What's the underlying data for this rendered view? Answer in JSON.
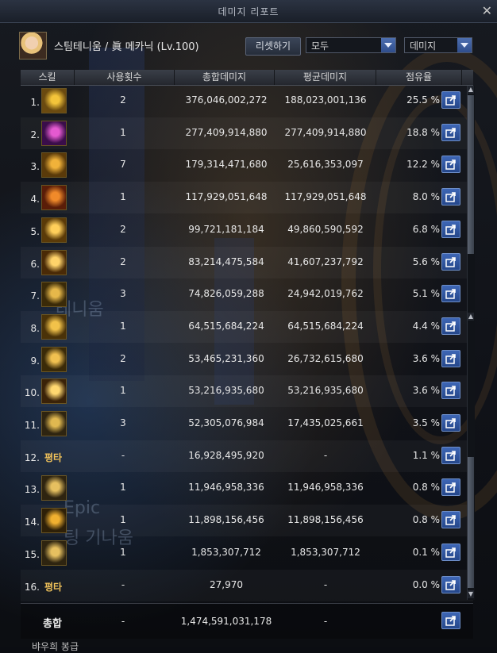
{
  "window": {
    "title": "데미지 리포트"
  },
  "character": {
    "name": "스팀테니움 / 眞 메카닉 (Lv.100)"
  },
  "controls": {
    "reset_label": "리셋하기",
    "filter_value": "모두",
    "metric_value": "데미지"
  },
  "columns": {
    "skill": "스킬",
    "uses": "사용횟수",
    "total": "총합데미지",
    "avg": "평균데미지",
    "share": "점유율"
  },
  "rows": [
    {
      "rank": "1.",
      "uses": "2",
      "total": "376,046,002,272",
      "avg": "188,023,001,136",
      "share": "25.5 %",
      "icon": "rifle-skill-icon"
    },
    {
      "rank": "2.",
      "uses": "1",
      "total": "277,409,914,880",
      "avg": "277,409,914,880",
      "share": "18.8 %",
      "icon": "purple-hex-skill-icon"
    },
    {
      "rank": "3.",
      "uses": "7",
      "total": "179,314,471,680",
      "avg": "25,616,353,097",
      "share": "12.2 %",
      "icon": "missile-barrage-icon"
    },
    {
      "rank": "4.",
      "uses": "1",
      "total": "117,929,051,648",
      "avg": "117,929,051,648",
      "share": "8.0 %",
      "icon": "robot-helmet-icon"
    },
    {
      "rank": "5.",
      "uses": "2",
      "total": "99,721,181,184",
      "avg": "49,860,590,592",
      "share": "6.8 %",
      "icon": "mech-fist-icon"
    },
    {
      "rank": "6.",
      "uses": "2",
      "total": "83,214,475,584",
      "avg": "41,607,237,792",
      "share": "5.6 %",
      "icon": "laser-beam-icon"
    },
    {
      "rank": "7.",
      "uses": "3",
      "total": "74,826,059,288",
      "avg": "24,942,019,762",
      "share": "5.1 %",
      "icon": "g3-drone-icon"
    },
    {
      "rank": "8.",
      "uses": "1",
      "total": "64,515,684,224",
      "avg": "64,515,684,224",
      "share": "4.4 %",
      "icon": "cannon-icon"
    },
    {
      "rank": "9.",
      "uses": "2",
      "total": "53,465,231,360",
      "avg": "26,732,615,680",
      "share": "3.6 %",
      "icon": "target-drone-icon"
    },
    {
      "rank": "10.",
      "uses": "1",
      "total": "53,216,935,680",
      "avg": "53,216,935,680",
      "share": "3.6 %",
      "icon": "explosion-icon"
    },
    {
      "rank": "11.",
      "uses": "3",
      "total": "52,305,076,984",
      "avg": "17,435,025,661",
      "share": "3.5 %",
      "icon": "g2-gear-icon"
    },
    {
      "rank": "12.",
      "uses": "-",
      "total": "16,928,495,920",
      "avg": "-",
      "share": "1.1 %",
      "icon": "",
      "text_label": "평타"
    },
    {
      "rank": "13.",
      "uses": "1",
      "total": "11,946,958,336",
      "avg": "11,946,958,336",
      "share": "0.8 %",
      "icon": "spider-mine-icon"
    },
    {
      "rank": "14.",
      "uses": "1",
      "total": "11,898,156,456",
      "avg": "11,898,156,456",
      "share": "0.8 %",
      "icon": "gear-icon"
    },
    {
      "rank": "15.",
      "uses": "1",
      "total": "1,853,307,712",
      "avg": "1,853,307,712",
      "share": "0.1 %",
      "icon": "g1-drone-icon"
    },
    {
      "rank": "16.",
      "uses": "-",
      "total": "27,970",
      "avg": "-",
      "share": "0.0 %",
      "icon": "",
      "text_label": "평타"
    }
  ],
  "total": {
    "label": "총합",
    "uses": "-",
    "total": "1,474,591,031,178",
    "avg": "-"
  },
  "footer": {
    "partial_text": "뱌우희 봉급"
  },
  "background": {
    "ghost_text_1": "Epic",
    "ghost_text_2": "팅 기나움",
    "ghost_text_3": "테니움"
  },
  "colors": {
    "accent": "#3e67b6",
    "gold": "#f0c25a"
  }
}
